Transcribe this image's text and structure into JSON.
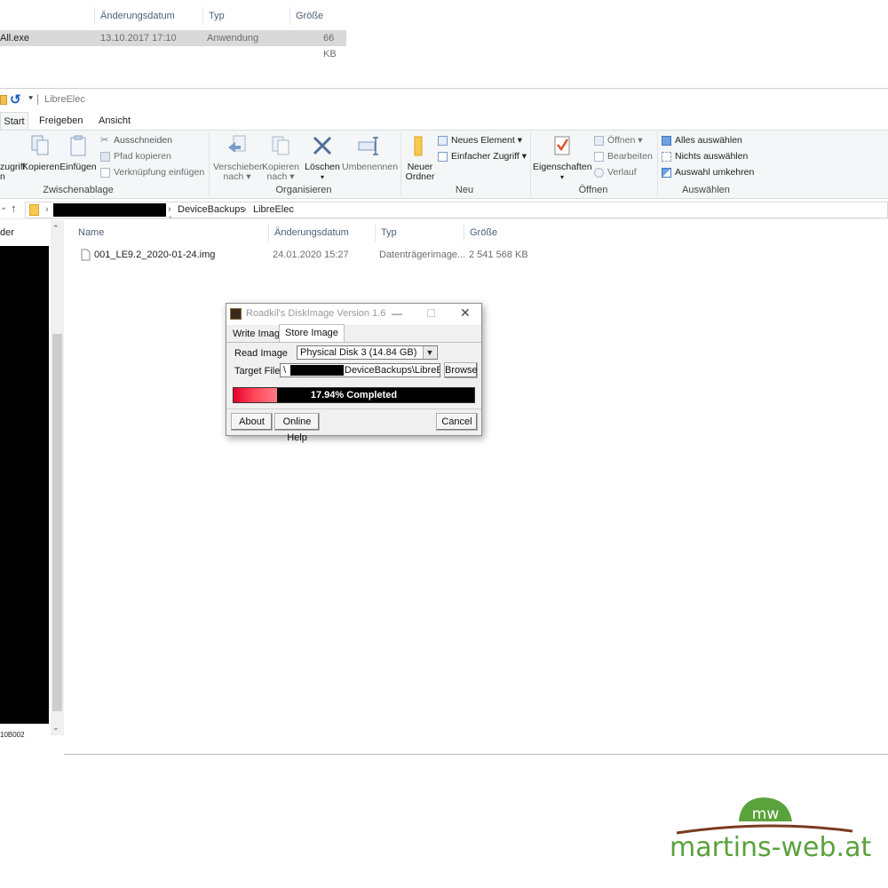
{
  "top_window": {
    "columns": [
      "Änderungsdatum",
      "Typ",
      "Größe"
    ],
    "row": {
      "name": "All.exe",
      "date": "13.10.2017 17:10",
      "type": "Anwendung",
      "size": "66 KB"
    }
  },
  "main_window": {
    "title": "LibreElec",
    "tabs": [
      "Start",
      "Freigeben",
      "Ansicht"
    ],
    "ribbon": {
      "clipboard": {
        "group_label": "Zwischenablage",
        "pin_label_1": "zugriff",
        "pin_label_2": "n",
        "copy": "Kopieren",
        "paste": "Einfügen",
        "cut": "Ausschneiden",
        "copy_path": "Pfad kopieren",
        "paste_shortcut": "Verknüpfung einfügen"
      },
      "organize": {
        "group_label": "Organisieren",
        "move_1": "Verschieben",
        "move_2": "nach ▾",
        "copy_to_1": "Kopieren",
        "copy_to_2": "nach ▾",
        "delete": "Löschen",
        "delete_arrow": "▾",
        "rename": "Umbenennen"
      },
      "new": {
        "group_label": "Neu",
        "new_folder_1": "Neuer",
        "new_folder_2": "Ordner",
        "new_item": "Neues Element ▾",
        "easy_access": "Einfacher Zugriff ▾"
      },
      "open": {
        "group_label": "Öffnen",
        "properties": "Eigenschaften",
        "properties_arrow": "▾",
        "open": "Öffnen ▾",
        "edit": "Bearbeiten",
        "history": "Verlauf"
      },
      "select": {
        "group_label": "Auswählen",
        "select_all": "Alles auswählen",
        "select_none": "Nichts auswählen",
        "invert": "Auswahl umkehren"
      }
    },
    "breadcrumb": [
      "DeviceBackups",
      "LibreElec"
    ],
    "nav_pane": {
      "header": "der",
      "footer": "10B002"
    },
    "file_list": {
      "columns": [
        "Name",
        "Änderungsdatum",
        "Typ",
        "Größe"
      ],
      "rows": [
        {
          "name": "001_LE9.2_2020-01-24.img",
          "date": "24.01.2020 15:27",
          "type": "Datenträgerimage...",
          "size": "2 541 568 KB"
        }
      ]
    }
  },
  "dialog": {
    "title": "Roadkil's DiskImage Version 1.6",
    "tabs": [
      "Write Image",
      "Store Image"
    ],
    "read_image_label": "Read Image",
    "read_image_value": "Physical Disk 3 (14.84 GB)",
    "target_file_label": "Target File",
    "target_file_prefix": "\\",
    "target_file_suffix": "DeviceBackups\\LibreElec",
    "browse": "Browse",
    "progress_percent": 17.94,
    "progress_text": "17.94% Completed",
    "about": "About",
    "online_help": "Online Help",
    "cancel": "Cancel"
  },
  "watermark": {
    "text": "martins-web.at",
    "badge": "mw",
    "brand_color": "#5aa23c"
  }
}
